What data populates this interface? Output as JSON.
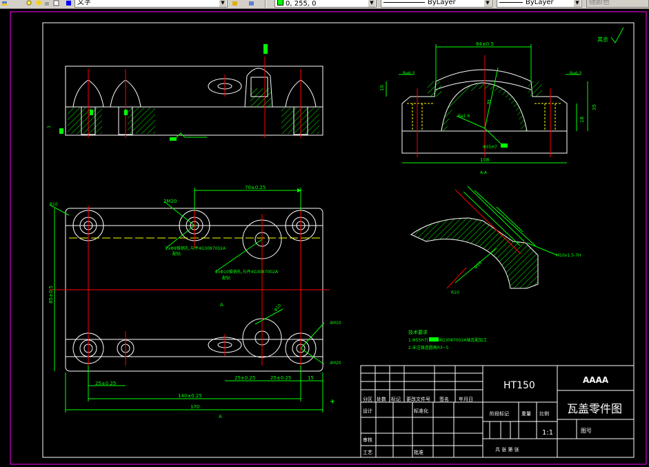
{
  "toolbar": {
    "text_style": "文字",
    "color_value": "0, 255, 0",
    "linetype": "ByLayer",
    "lineweight": "ByLayer",
    "plot_style": "随颜色"
  },
  "drawing": {
    "dims": {
      "d70": "70±0.25",
      "d140": "140±0.25",
      "d170": "170",
      "d25a": "25±0.25",
      "d25b": "25±0.25",
      "d25c": "25±0.25",
      "d15": "15",
      "d84": "84±0.5",
      "d108": "108",
      "d95": "95",
      "d85": "85±0.5",
      "d2m20": "2M20",
      "d4m10": "4M10",
      "d4m20": "4M20",
      "d3": "3",
      "d18": "18",
      "d10": "10",
      "d35": "35",
      "ra": "Ra6.3",
      "ra2": "Ra1.6",
      "hole1": "2xΦ8锥销孔,与件4G3087002A",
      "hole1b": "配钻",
      "hole2": "2xΦ10锥销孔,与件4G3087002A",
      "hole2b": "配钻",
      "ball": "Φ55H7",
      "phi": "Φ10",
      "r10": "R10",
      "section": "A-A",
      "mark_a": "A",
      "callout": "M10x1.5-7H",
      "other": "其余"
    },
    "notes": {
      "title": "技术要求",
      "line1": "1.Φ55H7(   )与件4G3087002A轴瓦配加工",
      "line2": "2.未注铸造圆角R3~5"
    }
  },
  "title_block": {
    "material": "HT150",
    "company": "AAAA",
    "part_name": "瓦盖零件图",
    "drawing_no_label": "图号",
    "scale_label": "比例",
    "scale_value": "1:1",
    "weight_label": "重量",
    "stage_label": "阶段标记",
    "design_label": "设计",
    "std_label": "标准化",
    "review_label": "审核",
    "process_label": "工艺",
    "approve_label": "批准",
    "sheets": "共  张  第  张",
    "rev_headers": [
      "分区",
      "处数",
      "标记",
      "更改文件号",
      "签名",
      "年月日"
    ]
  }
}
